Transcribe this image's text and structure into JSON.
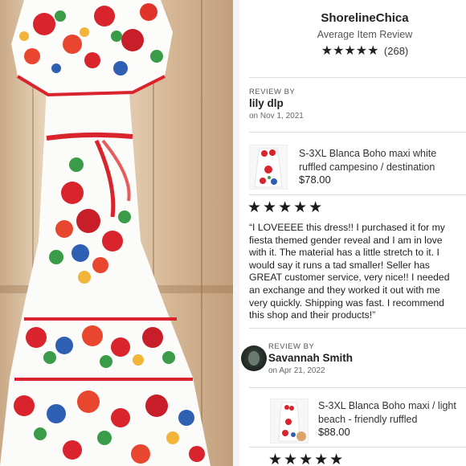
{
  "shop": {
    "name": "ShorelineChica",
    "average_label": "Average Item Review",
    "stars": "★★★★★",
    "review_count": "(268)"
  },
  "reviews": [
    {
      "label": "REVIEW BY",
      "reviewer": "lily dlp",
      "date": "on Nov 1, 2021",
      "item_title_lines": [
        "S-3XL Blanca Boho maxi white",
        "ruffled campesino / destination"
      ],
      "price": "$78.00",
      "stars": "★★★★★",
      "text_lines": [
        "“I LOVEEEE this dress!! I purchased it for my",
        "fiesta themed gender reveal and I am in love",
        "with it. The material has a little stretch to it. I",
        "would say it runs a tad smaller! Seller has",
        "GREAT customer service, very nice!! I needed",
        "an exchange and they worked it out with me",
        "very quickly. Shipping was fast. I recommend",
        "this shop and their products!”"
      ]
    },
    {
      "label": "REVIEW BY",
      "reviewer": "Savannah Smith",
      "date": "on Apr 21, 2022",
      "item_title_lines": [
        "S-3XL Blanca Boho maxi / light",
        "beach - friendly ruffled"
      ],
      "price": "$88.00",
      "stars": "★★★★★"
    }
  ],
  "colors": {
    "embroidery_red": "#d9232d",
    "embroidery_green": "#3a9b48",
    "embroidery_blue": "#2f5fb3",
    "dress_white": "#fbfbf9"
  }
}
